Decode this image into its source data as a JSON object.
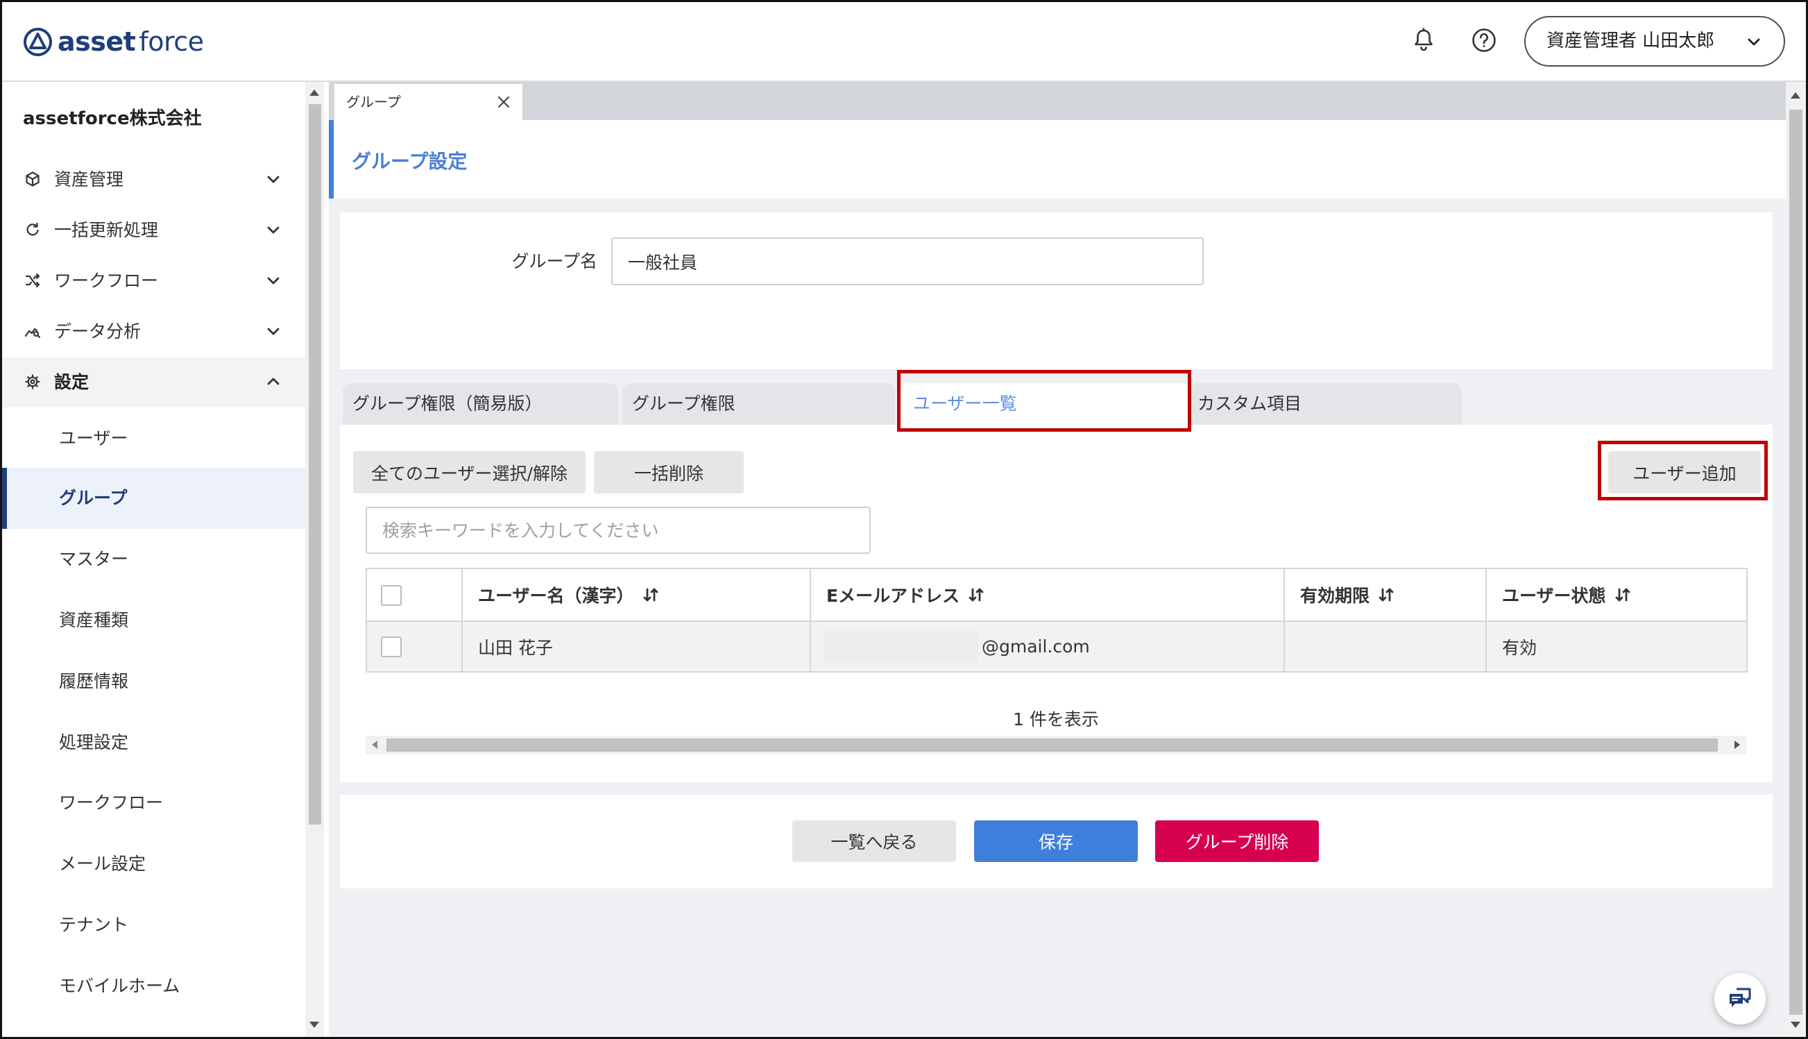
{
  "theme": {
    "brand": "#1f3e7a",
    "accent": "#3f80dc",
    "accent_text": "#4a7fd4",
    "danger": "#d6004f",
    "highlight_frame": "#c00000"
  },
  "header": {
    "logo": {
      "icon": "assetforce-logo-icon",
      "text_bold": "asset",
      "text_light": "force"
    },
    "notification_icon": "bell-icon",
    "help_icon": "question-circle-icon",
    "user_menu": {
      "label": "資産管理者 山田太郎",
      "icon": "chevron-down-icon"
    }
  },
  "sidebar": {
    "company_name": "assetforce株式会社",
    "menu": [
      {
        "label": "資産管理",
        "icon": "cube-icon",
        "expanded": false
      },
      {
        "label": "一括更新処理",
        "icon": "refresh-icon",
        "expanded": false
      },
      {
        "label": "ワークフロー",
        "icon": "workflow-icon",
        "expanded": false
      },
      {
        "label": "データ分析",
        "icon": "analytics-icon",
        "expanded": false
      },
      {
        "label": "設定",
        "icon": "gear-icon",
        "expanded": true
      }
    ],
    "settings_items": [
      {
        "label": "ユーザー",
        "active": false
      },
      {
        "label": "グループ",
        "active": true
      },
      {
        "label": "マスター",
        "active": false
      },
      {
        "label": "資産種類",
        "active": false
      },
      {
        "label": "履歴情報",
        "active": false
      },
      {
        "label": "処理設定",
        "active": false
      },
      {
        "label": "ワークフロー",
        "active": false
      },
      {
        "label": "メール設定",
        "active": false
      },
      {
        "label": "テナント",
        "active": false
      },
      {
        "label": "モバイルホーム",
        "active": false
      }
    ]
  },
  "page_tabs": [
    {
      "label": "グループ",
      "closable": true
    }
  ],
  "page": {
    "title": "グループ設定"
  },
  "group_form": {
    "name_label": "グループ名",
    "name_value": "一般社員"
  },
  "section_tabs": [
    {
      "label": "グループ権限（簡易版）",
      "active": false
    },
    {
      "label": "グループ権限",
      "active": false
    },
    {
      "label": "ユーザー一覧",
      "active": true,
      "highlighted": true
    },
    {
      "label": "カスタム項目",
      "active": false
    }
  ],
  "user_list": {
    "toolbar": {
      "select_all_label": "全てのユーザー選択/解除",
      "bulk_delete_label": "一括削除",
      "add_user_label": "ユーザー追加",
      "add_user_highlighted": true
    },
    "search": {
      "placeholder": "検索キーワードを入力してください",
      "value": ""
    },
    "select_all_checked": false,
    "columns": [
      {
        "label": "ユーザー名（漢字）",
        "sortable": true
      },
      {
        "label": "Eメールアドレス",
        "sortable": true
      },
      {
        "label": "有効期限",
        "sortable": true
      },
      {
        "label": "ユーザー状態",
        "sortable": true
      }
    ],
    "rows": [
      {
        "checked": false,
        "name": "山田 花子",
        "email_redacted": true,
        "email_visible": "@gmail.com",
        "expiry": "",
        "status": "有効"
      }
    ],
    "count_text": "1 件を表示"
  },
  "footer_actions": {
    "back_label": "一覧へ戻る",
    "save_label": "保存",
    "delete_label": "グループ削除"
  }
}
